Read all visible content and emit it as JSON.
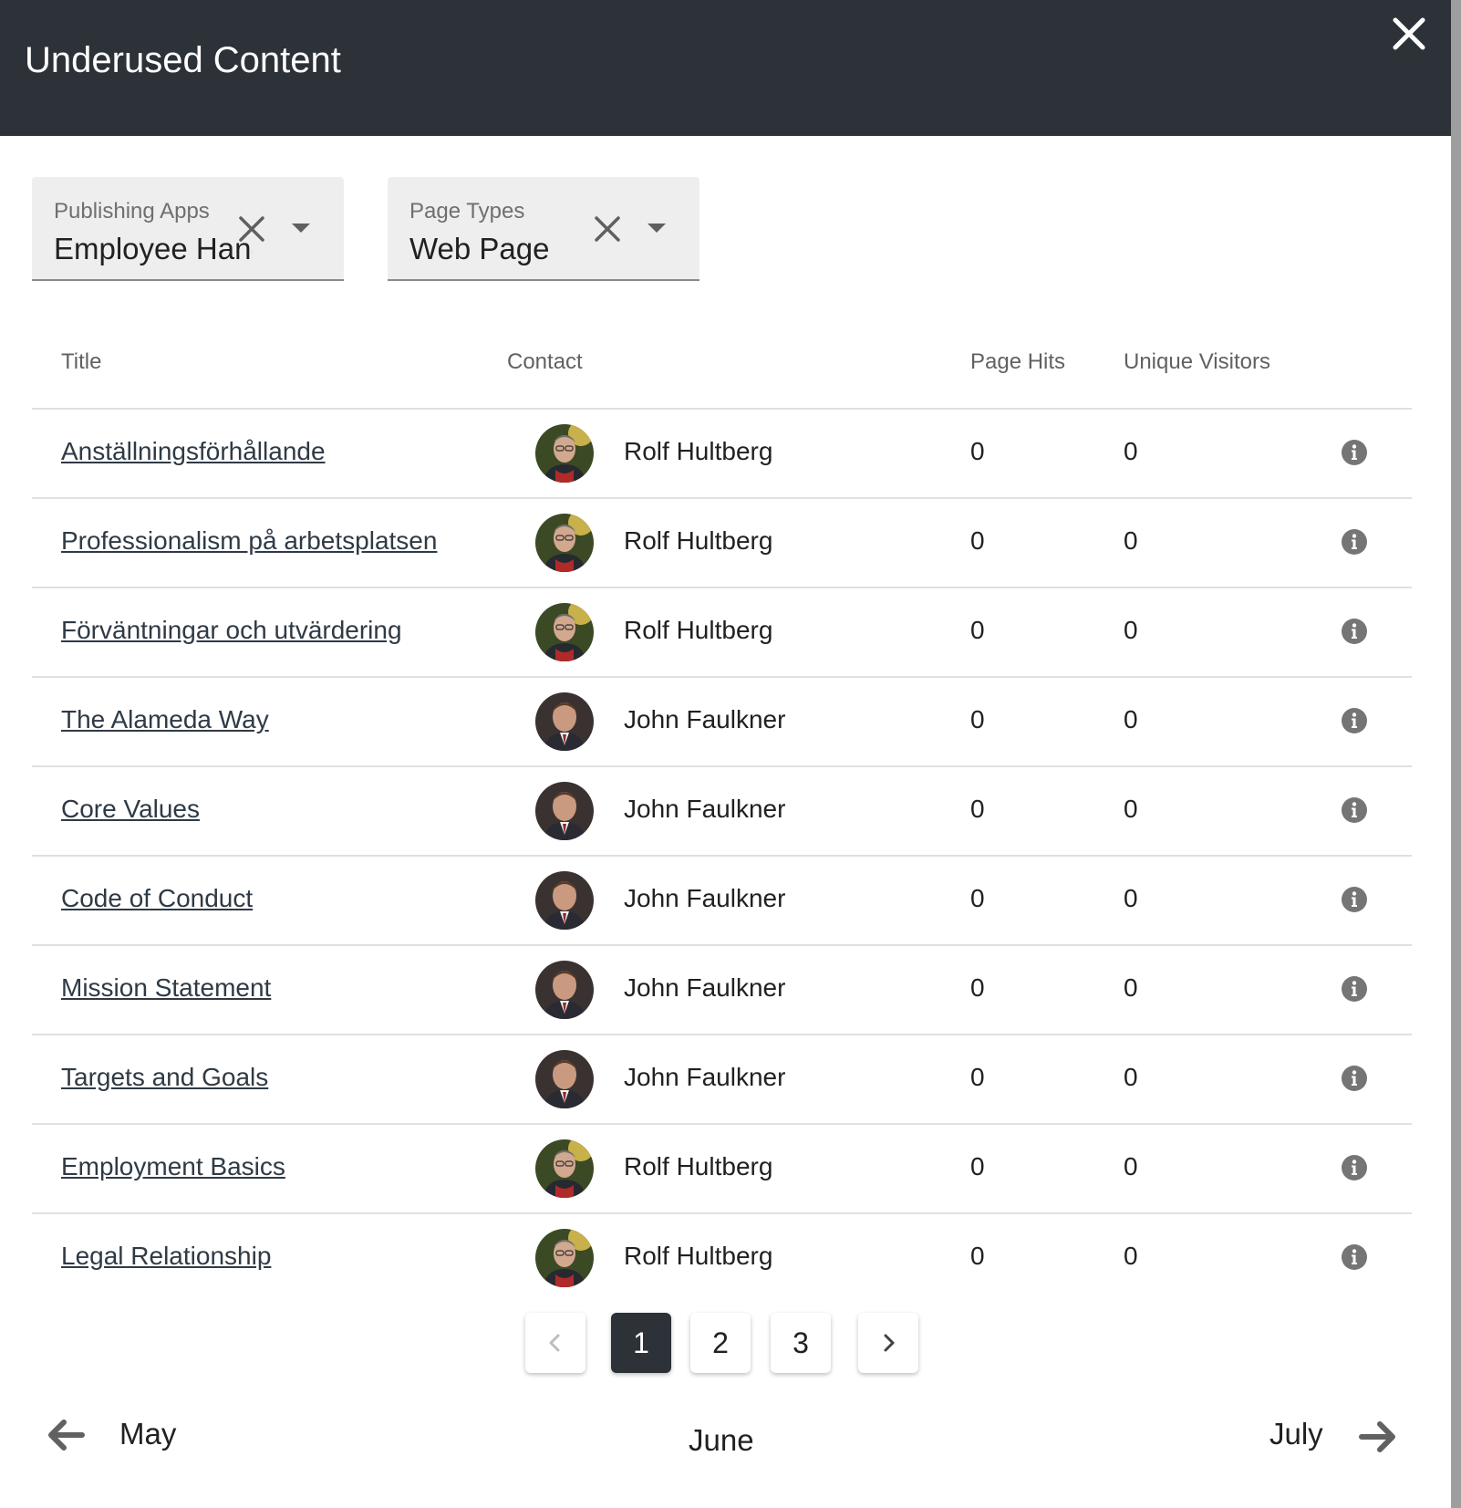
{
  "dialog": {
    "title": "Underused Content"
  },
  "filters": {
    "publishing_apps": {
      "label": "Publishing Apps",
      "value": "Employee Handbook"
    },
    "page_types": {
      "label": "Page Types",
      "value": "Web Page"
    }
  },
  "table": {
    "headers": {
      "title": "Title",
      "contact": "Contact",
      "page_hits": "Page Hits",
      "unique_visitors": "Unique Visitors"
    },
    "rows": [
      {
        "title": "Anställningsförhållande",
        "contact": "Rolf Hultberg",
        "page_hits": "0",
        "unique_visitors": "0"
      },
      {
        "title": "Professionalism på arbetsplatsen",
        "contact": "Rolf Hultberg",
        "page_hits": "0",
        "unique_visitors": "0"
      },
      {
        "title": "Förväntningar och utvärdering",
        "contact": "Rolf Hultberg",
        "page_hits": "0",
        "unique_visitors": "0"
      },
      {
        "title": "The Alameda Way",
        "contact": "John Faulkner",
        "page_hits": "0",
        "unique_visitors": "0"
      },
      {
        "title": "Core Values",
        "contact": "John Faulkner",
        "page_hits": "0",
        "unique_visitors": "0"
      },
      {
        "title": "Code of Conduct",
        "contact": "John Faulkner",
        "page_hits": "0",
        "unique_visitors": "0"
      },
      {
        "title": "Mission Statement",
        "contact": "John Faulkner",
        "page_hits": "0",
        "unique_visitors": "0"
      },
      {
        "title": "Targets and Goals",
        "contact": "John Faulkner",
        "page_hits": "0",
        "unique_visitors": "0"
      },
      {
        "title": "Employment Basics",
        "contact": "Rolf Hultberg",
        "page_hits": "0",
        "unique_visitors": "0"
      },
      {
        "title": "Legal Relationship",
        "contact": "Rolf Hultberg",
        "page_hits": "0",
        "unique_visitors": "0"
      }
    ]
  },
  "pagination": {
    "pages": [
      "1",
      "2",
      "3"
    ],
    "current": "1"
  },
  "month_nav": {
    "previous": "May",
    "current": "June",
    "next": "July"
  },
  "icons": {
    "close": "close-icon",
    "clear": "clear-icon",
    "dropdown": "chevron-down-icon",
    "info": "info-icon",
    "prev": "arrow-left-icon",
    "next": "arrow-right-icon"
  },
  "colors": {
    "header_bg": "#2d3239",
    "active_page_bg": "#2d3239",
    "info_icon": "#757575"
  }
}
